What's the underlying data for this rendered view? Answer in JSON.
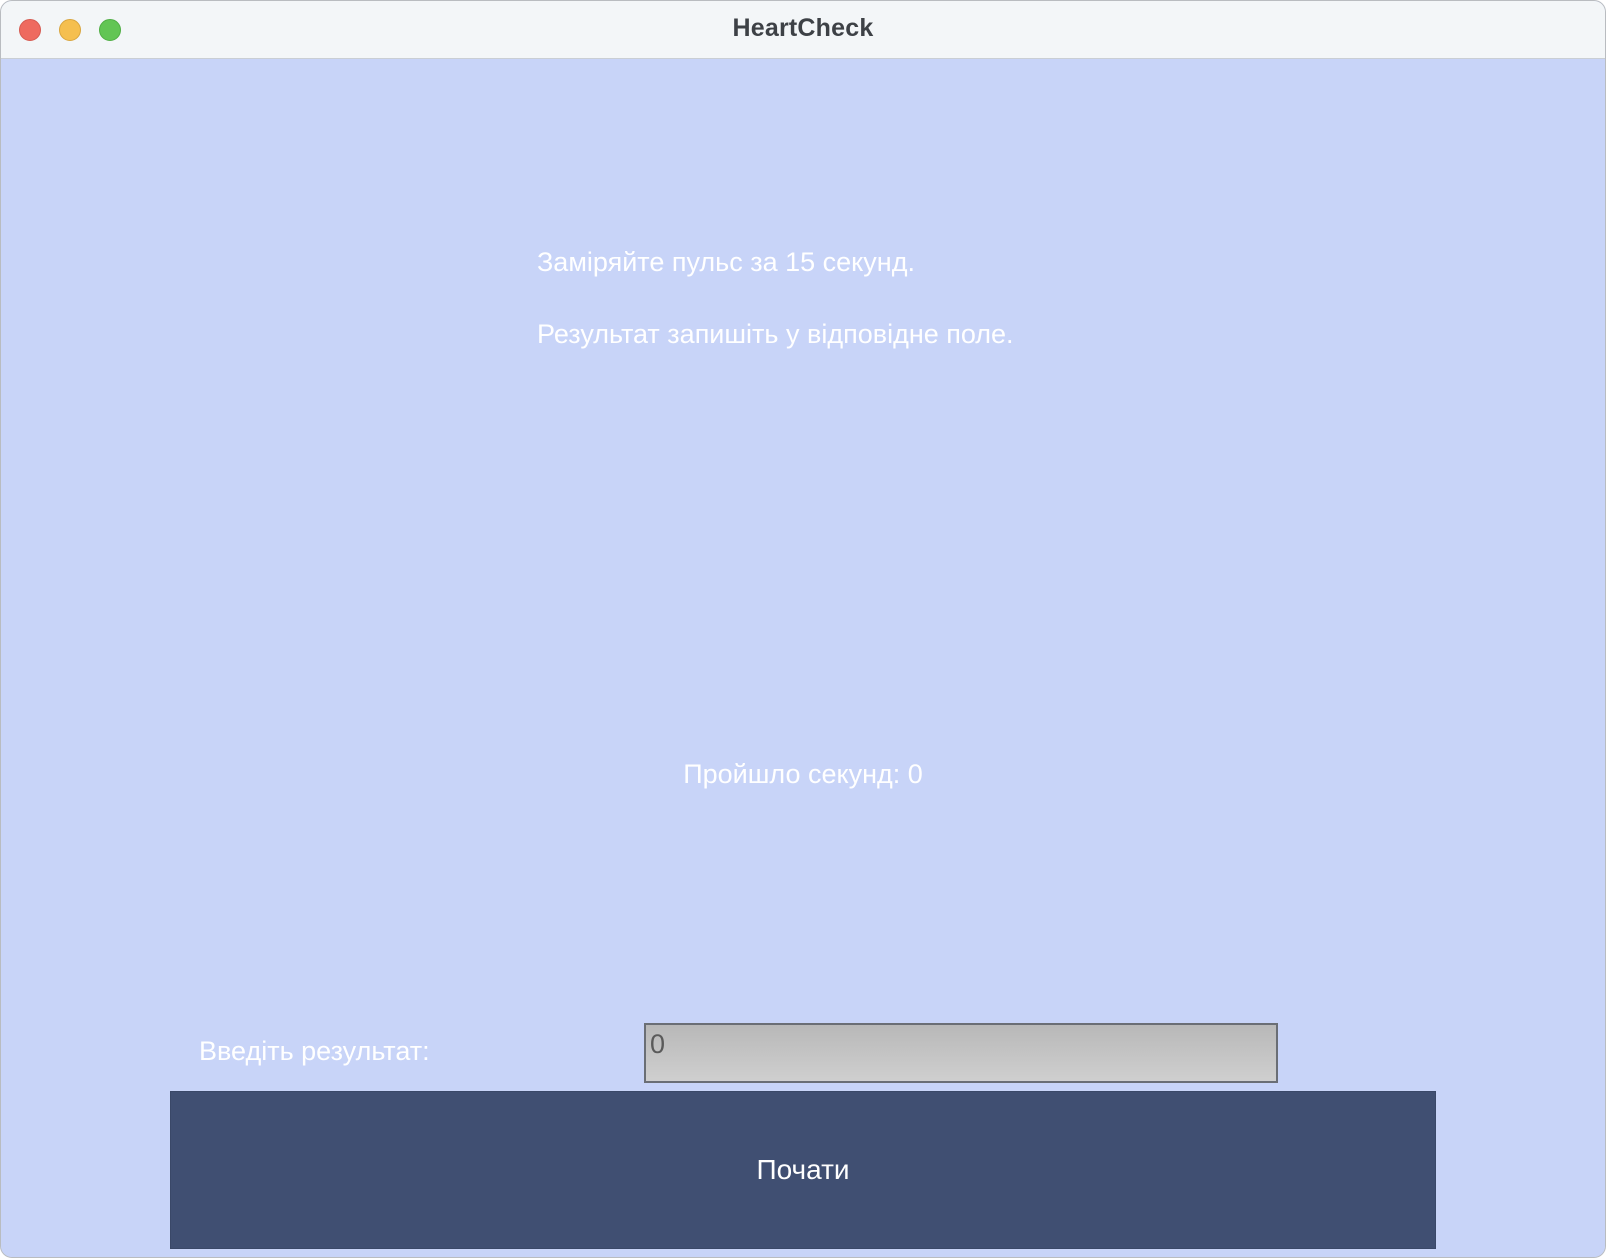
{
  "window": {
    "title": "HeartCheck",
    "controls": [
      "close-icon",
      "minimize-icon",
      "zoom-icon"
    ]
  },
  "main": {
    "instruction_line1": "Заміряйте пульс за 15 секунд.",
    "instruction_line2": "Результат запишіть у відповідне поле.",
    "timer_text": "Пройшло секунд: 0",
    "result_label": "Введіть результат:",
    "result_placeholder": "0",
    "start_button_label": "Почати"
  },
  "colors": {
    "background": "#c8d4f8",
    "button": "#404f72",
    "text": "#ffffff",
    "input_background": "#c4c4c4"
  }
}
